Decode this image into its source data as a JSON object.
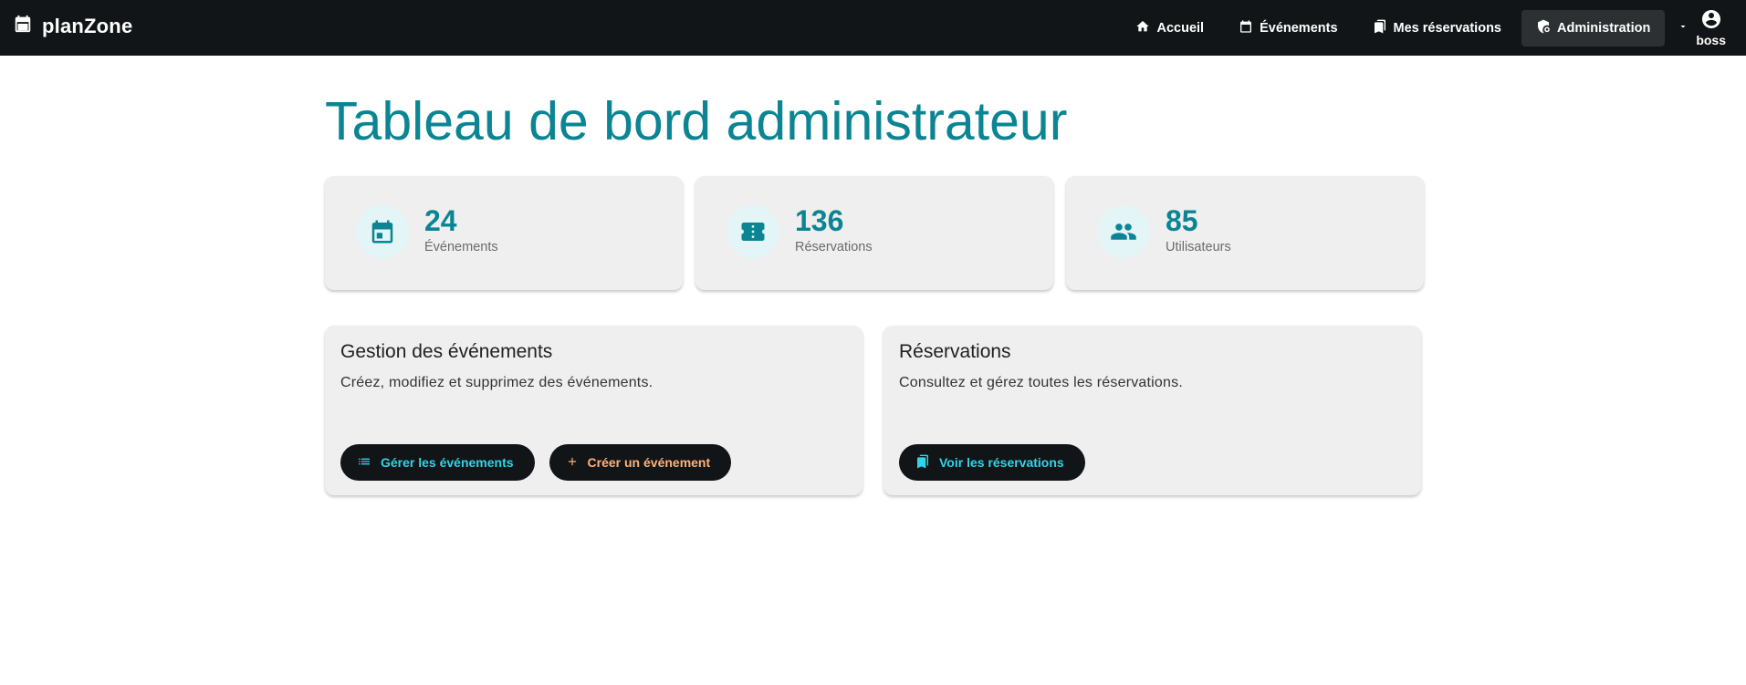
{
  "app": {
    "name": "planZone"
  },
  "nav": {
    "items": [
      {
        "label": "Accueil",
        "icon": "home-icon"
      },
      {
        "label": "Événements",
        "icon": "calendar-icon"
      },
      {
        "label": "Mes réservations",
        "icon": "bookmarks-icon"
      },
      {
        "label": "Administration",
        "icon": "admin-shield-icon",
        "active": true
      }
    ],
    "user": {
      "name": "boss"
    }
  },
  "page": {
    "title": "Tableau de bord administrateur"
  },
  "stats": [
    {
      "value": "24",
      "label": "Événements",
      "icon": "calendar-icon"
    },
    {
      "value": "136",
      "label": "Réservations",
      "icon": "ticket-icon"
    },
    {
      "value": "85",
      "label": "Utilisateurs",
      "icon": "people-icon"
    }
  ],
  "panels": {
    "events": {
      "title": "Gestion des événements",
      "description": "Créez, modifiez et supprimez des événements.",
      "buttons": [
        {
          "label": "Gérer les événements",
          "icon": "list-icon"
        },
        {
          "label": "Créer un événement",
          "icon": "plus-icon"
        }
      ]
    },
    "reservations": {
      "title": "Réservations",
      "description": "Consultez et gérez toutes les réservations.",
      "buttons": [
        {
          "label": "Voir les réservations",
          "icon": "bookmarks-icon"
        }
      ]
    }
  },
  "colors": {
    "accent": "#0b8593",
    "navbar": "#121517",
    "button_cyan": "#2fd5e6",
    "button_orange": "#ffb27a"
  }
}
